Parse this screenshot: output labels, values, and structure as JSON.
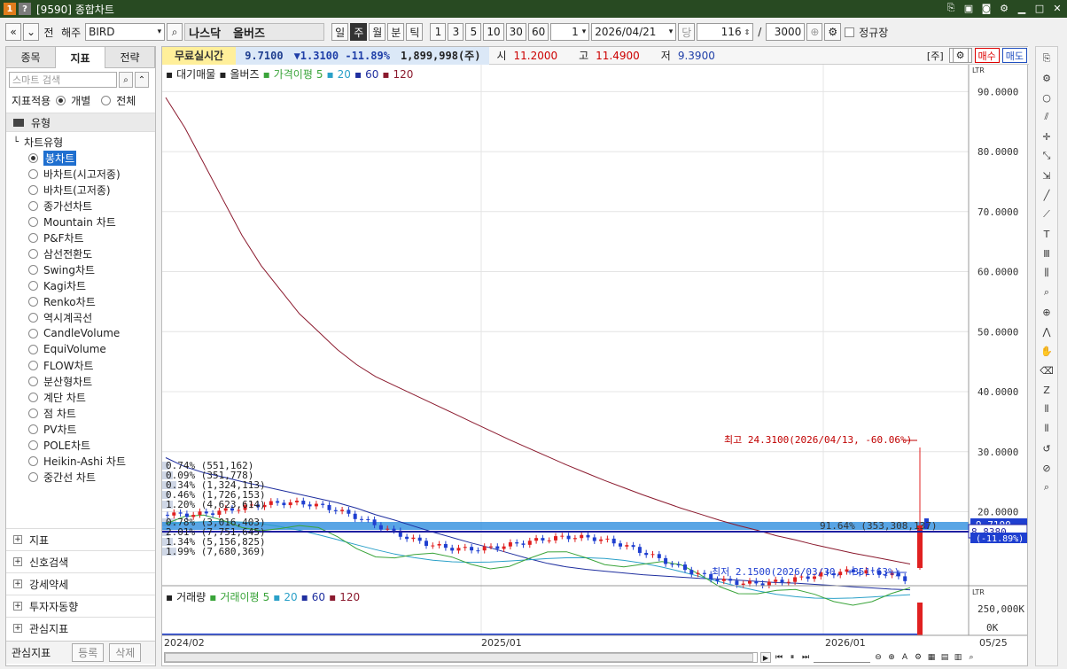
{
  "window": {
    "title": "[9590] 종합차트",
    "icon1": "1",
    "icon2": "?"
  },
  "toolbar": {
    "nav_left": "«",
    "nav_down": "»",
    "prev": "전",
    "market": "해주",
    "symbol": "BIRD",
    "exchange": "나스닥",
    "stock_name": "올버즈",
    "periods": [
      "일",
      "주",
      "월",
      "분",
      "틱"
    ],
    "active_period": "주",
    "intervals": [
      "1",
      "3",
      "5",
      "10",
      "30",
      "60"
    ],
    "count_value": "1",
    "date": "2026/04/21",
    "date_btn": "당",
    "bars": "116",
    "slash": "/",
    "total": "3000",
    "regular_label": "정규장"
  },
  "left": {
    "tabs": [
      "종목",
      "지표",
      "전략"
    ],
    "active_tab": "지표",
    "search_placeholder": "스마트 검색",
    "apply_label": "지표적용",
    "apply_opt1": "개별",
    "apply_opt2": "전체",
    "section": "유형",
    "tree_root": "차트유형",
    "items": [
      "봉차트",
      "바차트(시고저종)",
      "바차트(고저종)",
      "종가선차트",
      "Mountain 차트",
      "P&F차트",
      "삼선전환도",
      "Swing차트",
      "Kagi차트",
      "Renko차트",
      "역시계곡선",
      "CandleVolume",
      "EquiVolume",
      "FLOW차트",
      "분산형차트",
      "계단 차트",
      "점 차트",
      "PV차트",
      "POLE차트",
      "Heikin-Ashi 차트",
      "중간선 차트"
    ],
    "selected_item": "봉차트",
    "bottom_sections": [
      "지표",
      "신호검색",
      "강세약세",
      "투자자동향",
      "관심지표"
    ],
    "fav_label": "관심지표",
    "fav_add": "등록",
    "fav_del": "삭제"
  },
  "info": {
    "free_label": "무료실시간",
    "price": "9.7100",
    "change": "▼1.3100 -11.89%",
    "volume": "1,899,998(주)",
    "open_label": "시",
    "open": "11.2000",
    "high_label": "고",
    "high": "11.4900",
    "low_label": "저",
    "low": "9.3900",
    "unit_btn": "[주]",
    "buy_btn": "매수",
    "sell_btn": "매도"
  },
  "price_legend": {
    "l1": "대기매물",
    "l2": "올버즈",
    "l3": "가격이평",
    "p5": "5",
    "p20": "20",
    "p60": "60",
    "p120": "120"
  },
  "volume_legend": {
    "l1": "거래량",
    "l2": "거래이평",
    "p5": "5",
    "p20": "20",
    "p60": "60",
    "p120": "120"
  },
  "price_axis": [
    "90.0000",
    "80.0000",
    "70.0000",
    "60.0000",
    "50.0000",
    "40.0000",
    "30.0000",
    "20.0000"
  ],
  "volume_axis": [
    "250,000K",
    "0K"
  ],
  "x_axis": [
    "2024/02",
    "2025/01",
    "2026/01",
    "05/25"
  ],
  "annotations": {
    "high": "최고 24.3100(2026/04/13, -60.06%)",
    "low": "최저 2.1500(2026/03/30, +351.63%)",
    "current_price": "8.8380",
    "current_pct": "(-11.89%)",
    "current_price_top": "9.7100",
    "overhang_main": "91.64% (353,308,137)"
  },
  "overhang_labels": [
    "0.74% (551,162)",
    "0.09% (351,778)",
    "0.34% (1,324,113)",
    "0.46% (1,726,153)",
    "1.20% (4,623,614)",
    "0.78% (3,016,403)",
    "2.01% (7,751,645)",
    "1.34% (5,156,825)",
    "1.99% (7,680,369)"
  ],
  "colors": {
    "up": "#e02020",
    "down": "#1f3fd0",
    "ma5": "#3aa43a",
    "ma20": "#2aa0c8",
    "ma60": "#1f2f9f",
    "ma120": "#8b1a2e",
    "overhang": "#2f8fdf"
  },
  "chart_data": {
    "type": "candlestick",
    "y_range": [
      0,
      93
    ],
    "ma60": [
      29,
      27.5,
      26.5,
      25.8,
      25.0,
      24.3,
      23.6,
      22.9,
      22.2,
      21.5,
      20.6,
      19.5,
      18.6,
      17.6,
      16.6,
      15.7,
      14.8,
      14.0,
      13.1,
      12.2,
      11.4,
      10.8,
      10.4,
      10.1,
      9.8,
      9.5,
      9.3,
      9.1,
      8.9,
      8.8,
      8.6,
      8.4,
      8.2,
      8.1,
      7.9,
      7.7,
      7.5,
      7.3,
      7.1,
      7.0
    ],
    "ma120": [
      89,
      84,
      78,
      72,
      66,
      61,
      57,
      53,
      50,
      47,
      44.5,
      42.5,
      41,
      39.5,
      38,
      36.5,
      35,
      33.5,
      32,
      30.6,
      29.2,
      27.8,
      26.5,
      25.2,
      24,
      22.8,
      21.7,
      20.6,
      19.6,
      18.6,
      17.7,
      16.9,
      16,
      15.3,
      14.5,
      13.8,
      13.1,
      12.5,
      11.9,
      11.3
    ]
  }
}
